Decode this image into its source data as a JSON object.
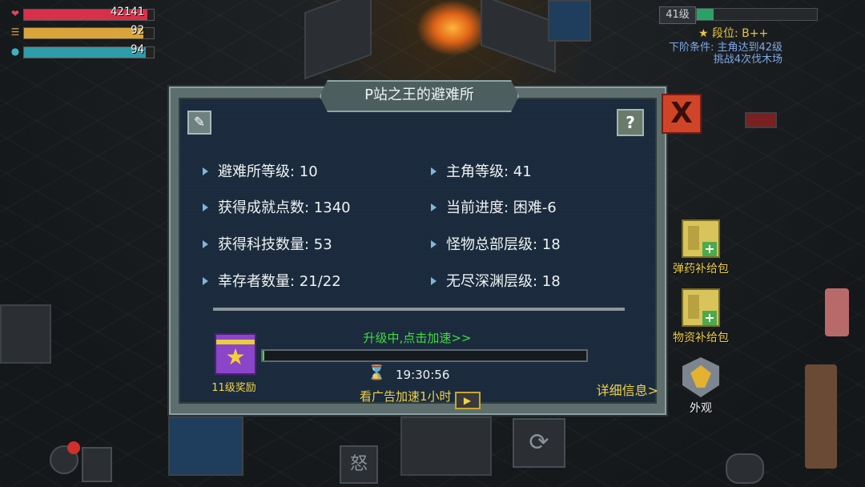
{
  "hud": {
    "health": {
      "icon": "heart-icon",
      "value": "42141",
      "fill_fraction": 0.95,
      "color": "#d8304a"
    },
    "food": {
      "icon": "food-icon",
      "value": "92",
      "fill_fraction": 0.92,
      "color": "#d9a43a"
    },
    "water": {
      "icon": "water-drop-icon",
      "value": "94",
      "fill_fraction": 0.94,
      "color": "#2f9aa8"
    },
    "level_badge": "41级",
    "level_progress_fraction": 0.14,
    "rank": "段位: B++",
    "next_condition_lines": [
      "下阶条件: 主角达到42级",
      "挑战4次伐木场"
    ]
  },
  "side_buttons": {
    "ammo_pack": "弹药补给包",
    "supply_pack": "物资补给包",
    "appearance": "外观"
  },
  "dialog": {
    "title": "P站之王的避难所",
    "help": "?",
    "close": "X",
    "info": {
      "shelter_level": "避难所等级: 10",
      "hero_level": "主角等级: 41",
      "achievement_points": "获得成就点数: 1340",
      "current_progress": "当前进度: 困难-6",
      "tech_count": "获得科技数量: 53",
      "monster_hq_floor": "怪物总部层级: 18",
      "survivors": "幸存者数量: 21/22",
      "abyss_floor": "无尽深渊层级: 18"
    },
    "reward_label": "11级奖励",
    "upgrade_hint": "升级中,点击加速>>",
    "upgrade_progress_fraction": 0.005,
    "timer": "19:30:56",
    "ad_speedup": "看广告加速1小时",
    "details_link": "详细信息>"
  },
  "bottom_icons": [
    "怒"
  ]
}
